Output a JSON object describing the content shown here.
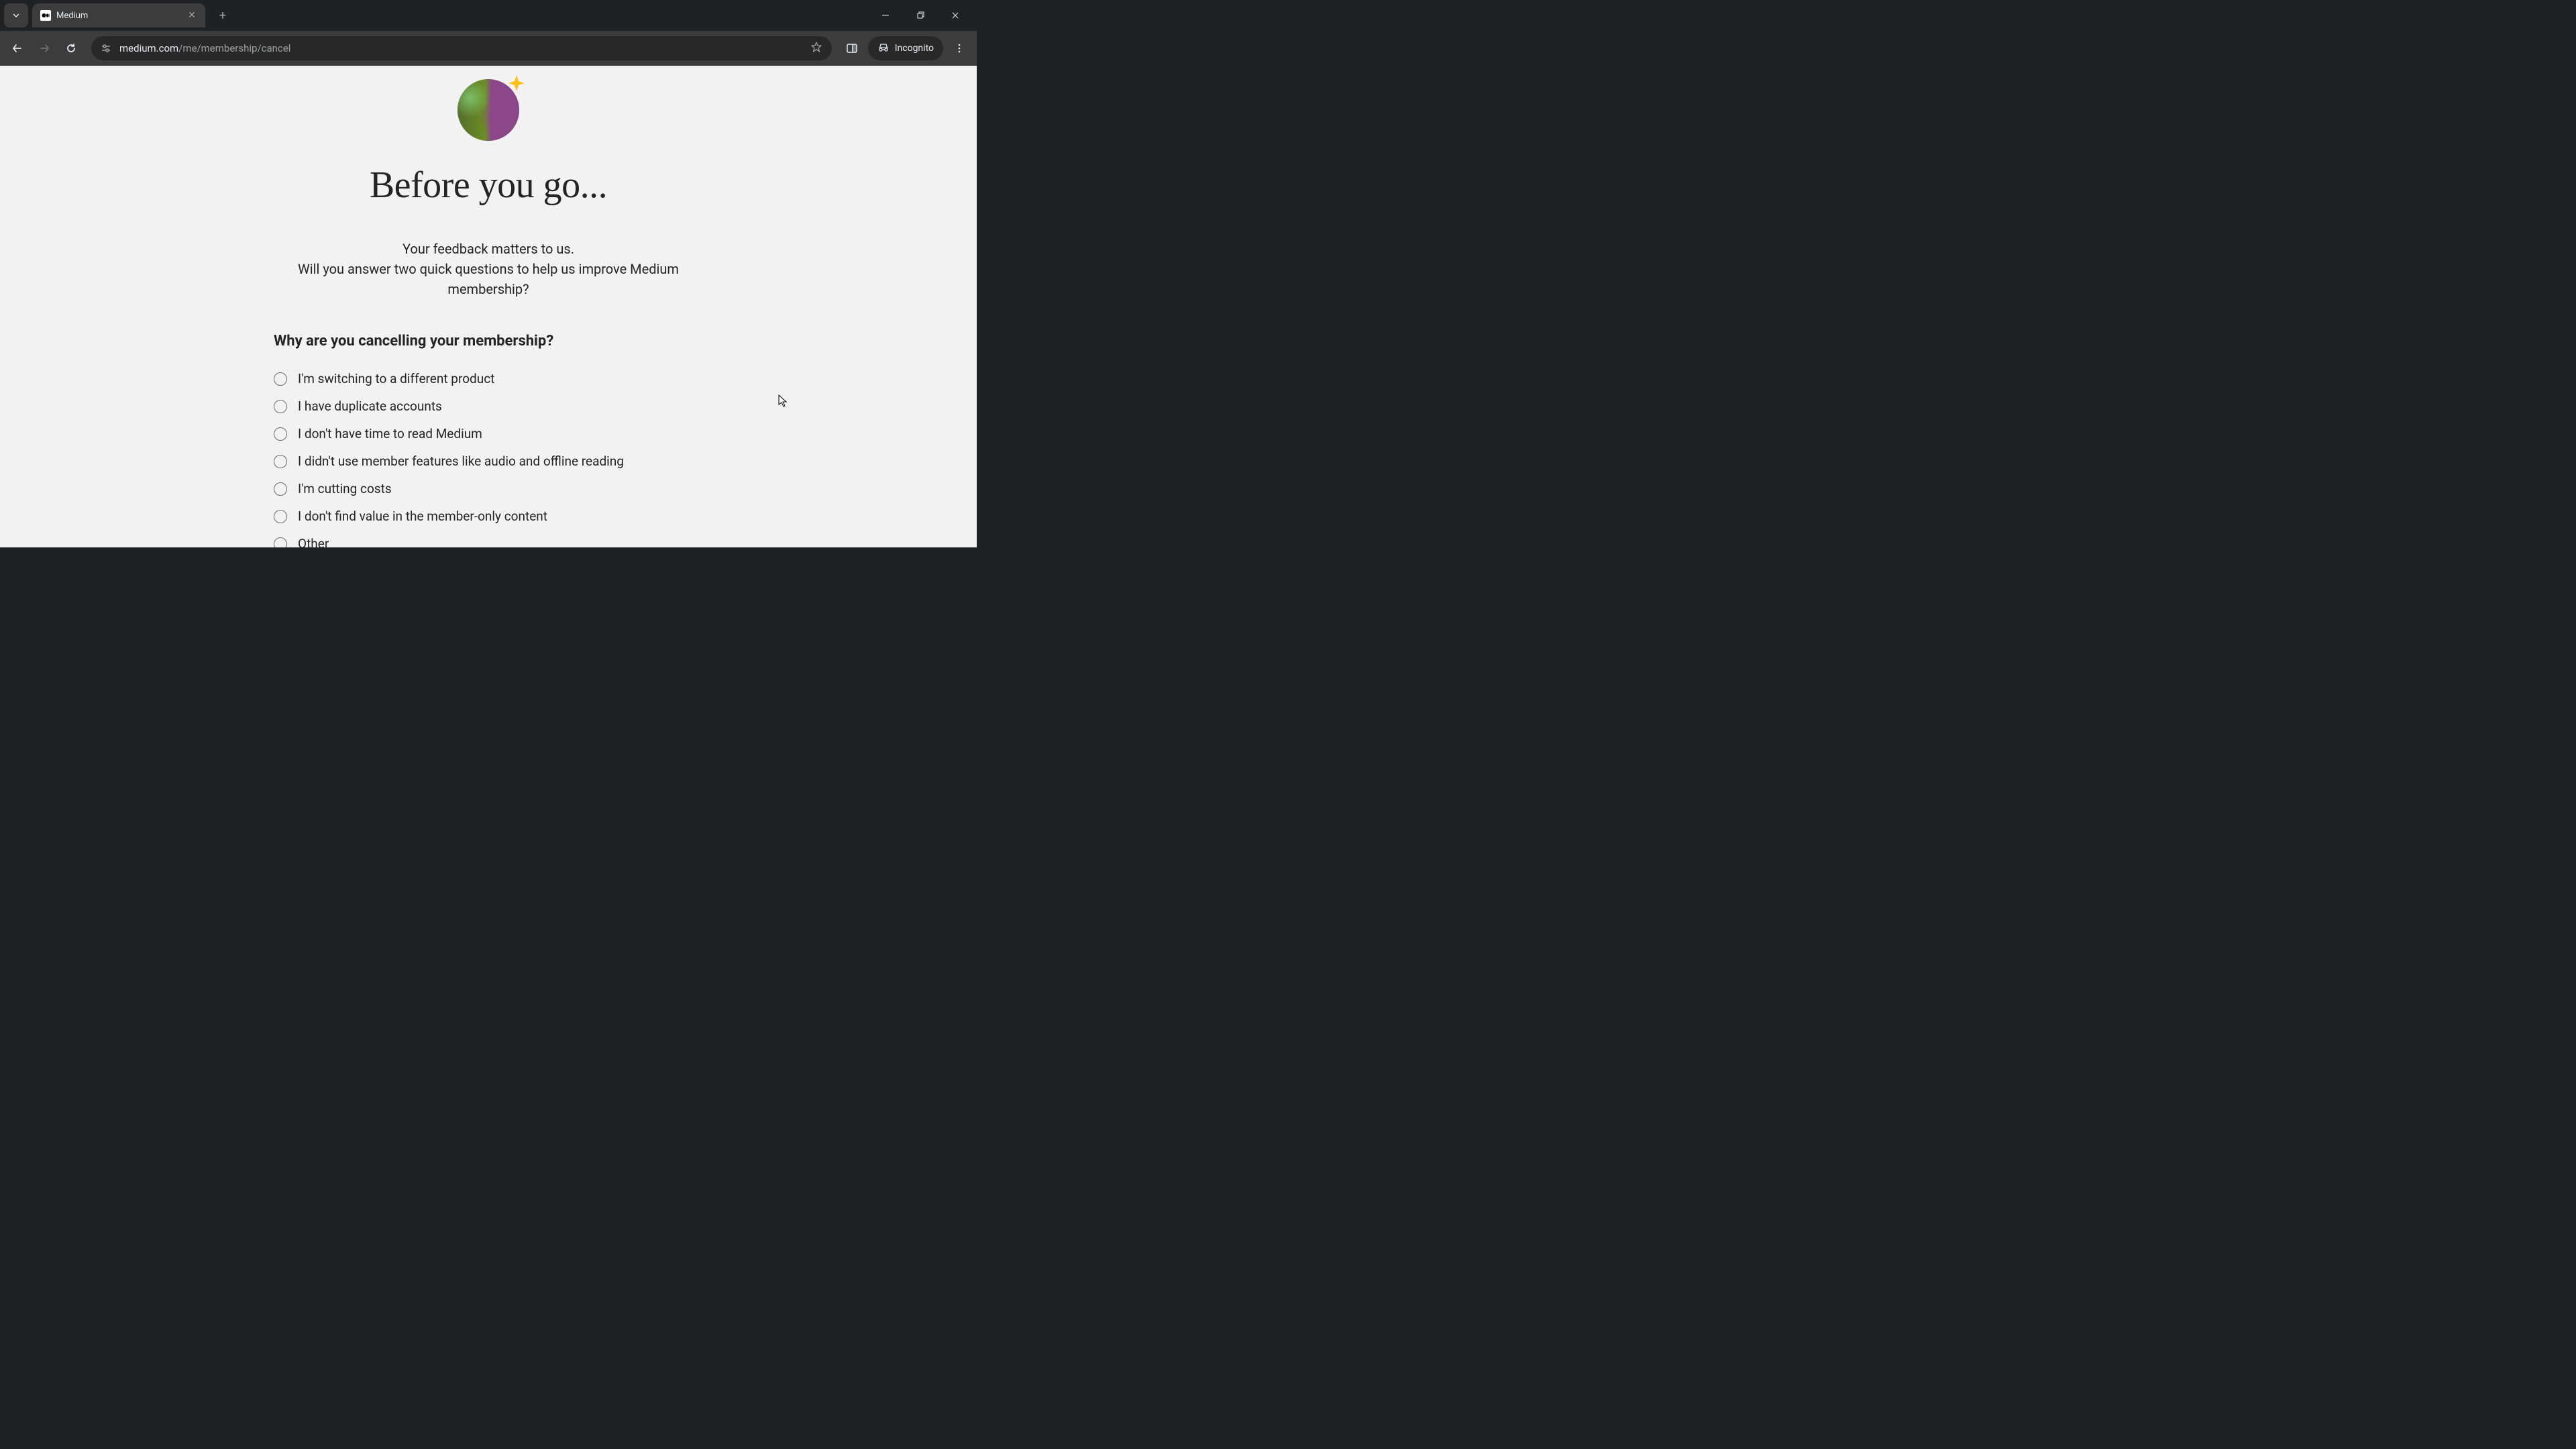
{
  "browser": {
    "tab_title": "Medium",
    "url_domain": "medium.com",
    "url_path": "/me/membership/cancel",
    "incognito_label": "Incognito"
  },
  "page": {
    "heading": "Before you go...",
    "subtitle_line1": "Your feedback matters to us.",
    "subtitle_line2": "Will you answer two quick questions to help us improve Medium membership?",
    "question": "Why are you cancelling your membership?",
    "options": [
      "I'm switching to a different product",
      "I have duplicate accounts",
      "I don't have time to read Medium",
      "I didn't use member features like audio and offline reading",
      "I'm cutting costs",
      "I don't find value in the member-only content",
      "Other"
    ]
  }
}
